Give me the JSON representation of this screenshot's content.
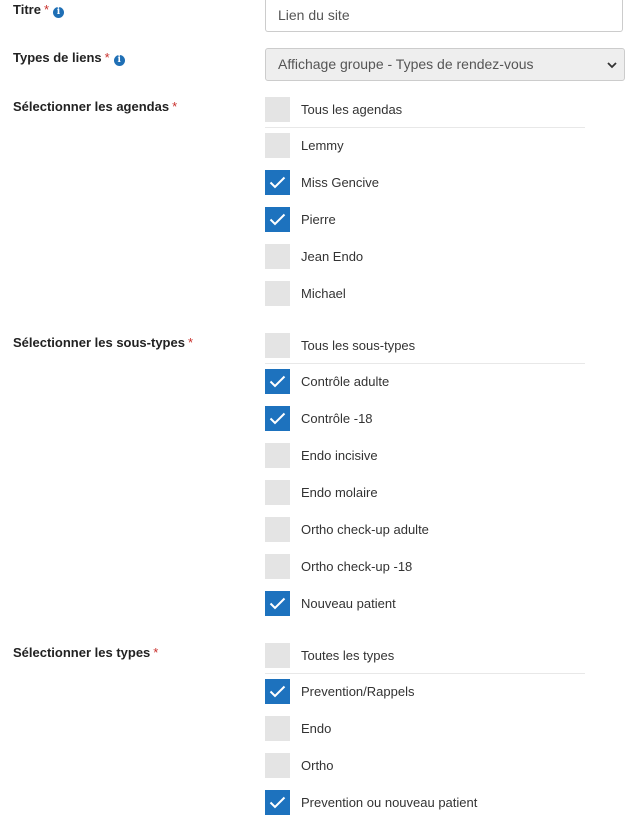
{
  "titre": {
    "label": "Titre",
    "required_mark": "*",
    "value": "Lien du site"
  },
  "types_de_liens": {
    "label": "Types de liens",
    "required_mark": "*",
    "selected": "Affichage groupe - Types de rendez-vous"
  },
  "agendas": {
    "label": "Sélectionner les agendas",
    "required_mark": "*",
    "options": [
      {
        "label": "Tous les agendas",
        "checked": false
      },
      {
        "label": "Lemmy",
        "checked": false
      },
      {
        "label": "Miss Gencive",
        "checked": true
      },
      {
        "label": "Pierre",
        "checked": true
      },
      {
        "label": "Jean Endo",
        "checked": false
      },
      {
        "label": "Michael",
        "checked": false
      }
    ]
  },
  "sous_types": {
    "label": "Sélectionner les sous-types",
    "required_mark": "*",
    "options": [
      {
        "label": "Tous les sous-types",
        "checked": false
      },
      {
        "label": "Contrôle adulte",
        "checked": true
      },
      {
        "label": "Contrôle -18",
        "checked": true
      },
      {
        "label": "Endo incisive",
        "checked": false
      },
      {
        "label": "Endo molaire",
        "checked": false
      },
      {
        "label": "Ortho check-up adulte",
        "checked": false
      },
      {
        "label": "Ortho check-up -18",
        "checked": false
      },
      {
        "label": "Nouveau patient",
        "checked": true
      }
    ]
  },
  "types": {
    "label": "Sélectionner les types",
    "required_mark": "*",
    "options": [
      {
        "label": "Toutes les types",
        "checked": false
      },
      {
        "label": "Prevention/Rappels",
        "checked": true
      },
      {
        "label": "Endo",
        "checked": false
      },
      {
        "label": "Ortho",
        "checked": false
      },
      {
        "label": "Prevention ou nouveau patient",
        "checked": true
      }
    ]
  },
  "icons": {
    "info": "info-circle-icon",
    "check": "checkmark-icon",
    "dropdown": "chevron-down-icon"
  },
  "colors": {
    "checked": "#1d72be",
    "unchecked": "#e4e4e4",
    "required": "#c9302c",
    "info": "#1f6fb5"
  }
}
